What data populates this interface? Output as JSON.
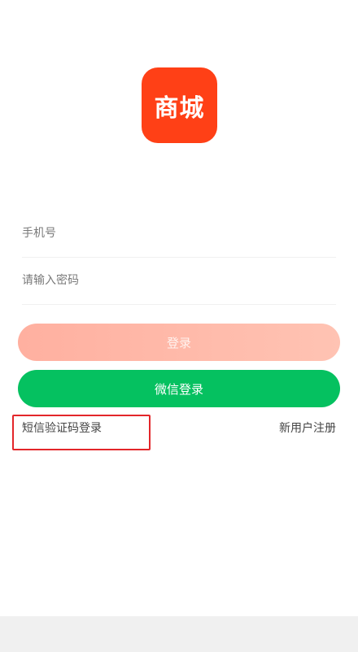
{
  "logo": {
    "text": "商城",
    "color": "#ff4016"
  },
  "form": {
    "phone_placeholder": "手机号",
    "password_placeholder": "请输入密码"
  },
  "buttons": {
    "login_label": "登录",
    "wechat_label": "微信登录",
    "wechat_color": "#05c160"
  },
  "links": {
    "sms_login": "短信验证码登录",
    "register": "新用户注册"
  }
}
